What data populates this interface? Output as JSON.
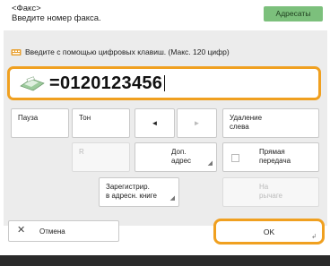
{
  "header": {
    "title": "<Факс>",
    "subtitle": "Введите номер факса.",
    "address_book_button": "Адресаты"
  },
  "hint": {
    "text": "Введите с помощью цифровых клавиш. (Макс. 120 цифр)",
    "icon": "keypad-icon"
  },
  "fax_field": {
    "value": "=0120123456",
    "icon": "fax-machine-icon"
  },
  "keys": {
    "pause": "Пауза",
    "tone": "Тон",
    "left_arrow": "◄",
    "right_arrow": "►",
    "delete_left_line1": "Удаление",
    "delete_left_line2": "слева",
    "r": "R",
    "subaddr_line1": "Доп.",
    "subaddr_line2": "адрес",
    "direct_line1": "Прямая",
    "direct_line2": "передача",
    "register_line1": "Зарегистрир.",
    "register_line2": "в адресн. книге",
    "hook_line1": "На",
    "hook_line2": "рычаге"
  },
  "bottom": {
    "cancel": "Отмена",
    "ok": "OK"
  },
  "colors": {
    "accent": "#f0a020",
    "address_button": "#7cc07c"
  }
}
